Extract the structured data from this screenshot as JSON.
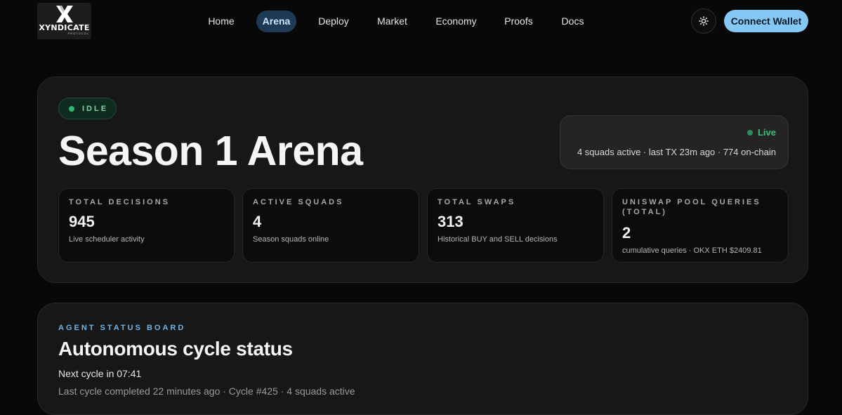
{
  "brand": {
    "name": "XYNDICATE",
    "subtitle": "PROTOCOL"
  },
  "nav": {
    "items": [
      {
        "label": "Home",
        "active": false
      },
      {
        "label": "Arena",
        "active": true
      },
      {
        "label": "Deploy",
        "active": false
      },
      {
        "label": "Market",
        "active": false
      },
      {
        "label": "Economy",
        "active": false
      },
      {
        "label": "Proofs",
        "active": false
      },
      {
        "label": "Docs",
        "active": false
      }
    ],
    "theme_toggle_icon": "sun-icon",
    "wallet_label": "Connect Wallet"
  },
  "hero": {
    "status": "IDLE",
    "title": "Season 1 Arena",
    "live": {
      "label": "Live",
      "detail": "4 squads active · last TX 23m ago · 774 on-chain"
    },
    "stats": [
      {
        "label": "TOTAL DECISIONS",
        "value": "945",
        "desc": "Live scheduler activity"
      },
      {
        "label": "ACTIVE SQUADS",
        "value": "4",
        "desc": "Season squads online"
      },
      {
        "label": "TOTAL SWAPS",
        "value": "313",
        "desc": "Historical BUY and SELL decisions"
      },
      {
        "label": "UNISWAP POOL QUERIES (TOTAL)",
        "value": "2",
        "desc": "cumulative queries · OKX ETH $2409.81"
      }
    ]
  },
  "board": {
    "eyebrow": "AGENT STATUS BOARD",
    "title": "Autonomous cycle status",
    "next_cycle": "Next cycle in 07:41",
    "last_cycle": "Last cycle completed 22 minutes ago · Cycle #425 · 4 squads active"
  },
  "colors": {
    "accent": "#86c8f5",
    "nav_active_bg": "#1d3b57",
    "live_green": "#38c17c",
    "idle_green": "#2fb872"
  }
}
